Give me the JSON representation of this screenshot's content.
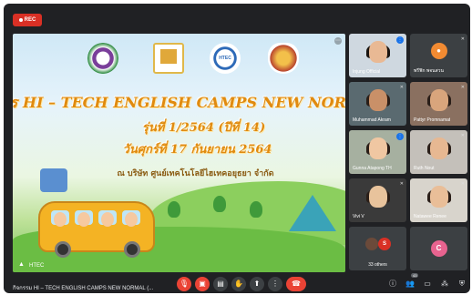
{
  "rec_label": "REC",
  "presentation": {
    "line1": "การ HI – TECH  ENGLISH CAMPS NEW NORMAL (ONI",
    "line2": "รุ่นที่  1/2564  (ปีที่ 14)",
    "line3": "วันศุกร์ที่ 17  กันยายน  2564",
    "line4": "ณ บริษัท ศูนย์เทคโนโลยีไฮเทคอยุธยา จำกัด",
    "logo3_text": "HTEC",
    "speaker_name": "HTEC"
  },
  "participants": [
    {
      "name": "Injung Official",
      "badge": "⋮"
    },
    {
      "name": "พรีฟิก พจนสวน",
      "initial": ""
    },
    {
      "name": "Muhammad Akram"
    },
    {
      "name": "Pattyr Promnamat"
    },
    {
      "name": "Gunna Atapong TH"
    },
    {
      "name": "Ruth Nout"
    },
    {
      "name": "Vivi V"
    },
    {
      "name": "Natawee Renee"
    },
    {
      "name": "33 others",
      "initial": "S"
    },
    {
      "name": "",
      "initial": "C"
    }
  ],
  "bottom_title": "กิจกรรม HI – TECH ENGLISH CAMPS NEW NORMAL (...",
  "people_count": "43",
  "colors": {
    "avatar_orange": "#f28b32",
    "avatar_pink": "#e8638f",
    "others_red": "#d93025"
  }
}
